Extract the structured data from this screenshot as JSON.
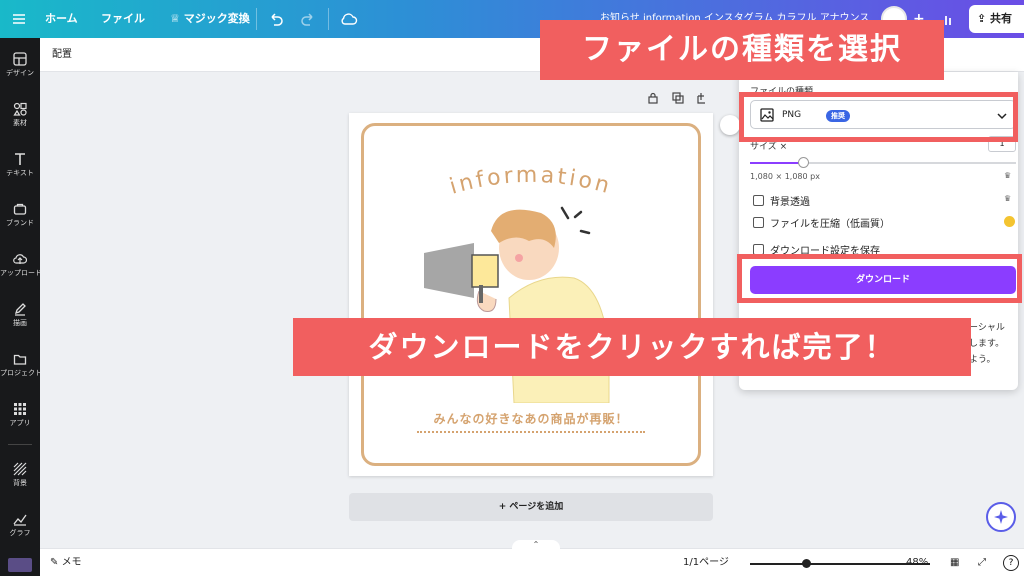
{
  "topbar": {
    "home": "ホーム",
    "file": "ファイル",
    "magic": "マジック変換",
    "doc_title": "お知らせ information インスタグラム カラフル アナウンス",
    "plus": "+",
    "share": "共有"
  },
  "rail": [
    {
      "label": "デザイン",
      "icon": "design-icon"
    },
    {
      "label": "素材",
      "icon": "elements-icon"
    },
    {
      "label": "テキスト",
      "icon": "text-icon"
    },
    {
      "label": "ブランド",
      "icon": "brand-icon"
    },
    {
      "label": "アップロード",
      "icon": "upload-icon"
    },
    {
      "label": "描画",
      "icon": "draw-icon"
    },
    {
      "label": "プロジェクト",
      "icon": "folder-icon"
    },
    {
      "label": "アプリ",
      "icon": "apps-icon"
    },
    {
      "label": "背景",
      "icon": "background-icon"
    },
    {
      "label": "グラフ",
      "icon": "chart-icon"
    }
  ],
  "subheader": {
    "position_label": "配置"
  },
  "design": {
    "heading": "information",
    "caption": "みんなの好きなあの商品が再販！"
  },
  "add_page": "+ ページを追加",
  "panel": {
    "file_type_label": "ファイルの種類",
    "file_type": "PNG",
    "recommended_badge": "推奨",
    "size_label": "サイズ ×",
    "size_value": "1",
    "size_slider_fraction": 0.2,
    "dimensions": "1,080 × 1,080 px",
    "transparent_bg": "背景透過",
    "compress": "ファイルを圧縮（低画質）",
    "save_settings": "ダウンロード設定を保存",
    "download": "ダウンロード",
    "note_1": "ーシャル",
    "note_2": "します。",
    "note_3": "よう。"
  },
  "bottombar": {
    "notes": "メモ",
    "pages": "1/1ページ",
    "zoom": "48%",
    "zoom_fraction": 0.31,
    "help": "?"
  },
  "overlay": {
    "top_banner": "ファイルの種類を選択",
    "mid_banner": "ダウンロードをクリックすれば完了！"
  },
  "colors": {
    "accent": "#8b3dff",
    "annotation": "#f15f5f",
    "frame": "#dbb080"
  }
}
